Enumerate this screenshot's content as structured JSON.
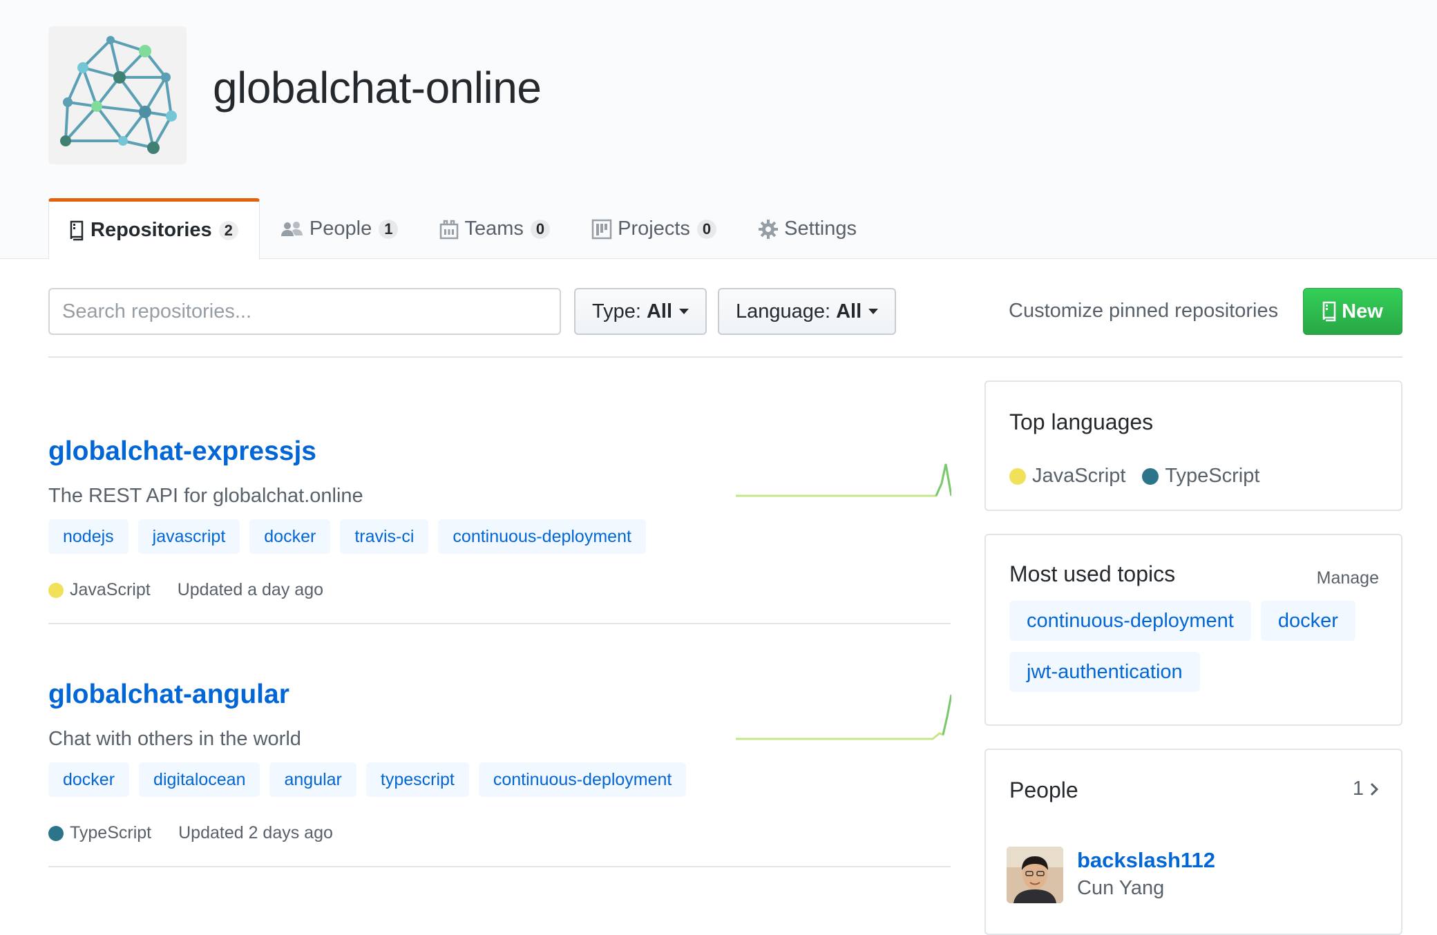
{
  "org": {
    "name": "globalchat-online",
    "avatar_icon": "network-graph-logo"
  },
  "tabs": [
    {
      "label": "Repositories",
      "count": "2",
      "icon": "repo-icon"
    },
    {
      "label": "People",
      "count": "1",
      "icon": "people-icon"
    },
    {
      "label": "Teams",
      "count": "0",
      "icon": "teams-icon"
    },
    {
      "label": "Projects",
      "count": "0",
      "icon": "project-icon"
    },
    {
      "label": "Settings",
      "icon": "gear-icon"
    }
  ],
  "filters": {
    "search_placeholder": "Search repositories...",
    "type_label": "Type:",
    "type_value": "All",
    "language_label": "Language:",
    "language_value": "All",
    "customize_link": "Customize pinned repositories",
    "new_button": "New"
  },
  "repos": [
    {
      "name": "globalchat-expressjs",
      "description": "The REST API for globalchat.online",
      "topics": [
        "nodejs",
        "javascript",
        "docker",
        "travis-ci",
        "continuous-deployment"
      ],
      "language": "JavaScript",
      "language_color": "#f1e05a",
      "updated": "Updated a day ago"
    },
    {
      "name": "globalchat-angular",
      "description": "Chat with others in the world",
      "topics": [
        "docker",
        "digitalocean",
        "angular",
        "typescript",
        "continuous-deployment"
      ],
      "language": "TypeScript",
      "language_color": "#2b7489",
      "updated": "Updated 2 days ago"
    }
  ],
  "sidebar": {
    "top_languages": {
      "title": "Top languages",
      "items": [
        {
          "name": "JavaScript",
          "color": "#f1e05a"
        },
        {
          "name": "TypeScript",
          "color": "#2b7489"
        }
      ]
    },
    "topics": {
      "title": "Most used topics",
      "manage": "Manage",
      "items": [
        "continuous-deployment",
        "docker",
        "jwt-authentication"
      ]
    },
    "people": {
      "title": "People",
      "count": "1",
      "members": [
        {
          "login": "backslash112",
          "name": "Cun Yang"
        }
      ]
    }
  },
  "colors": {
    "accent_tab": "#e36209",
    "link": "#0366d6",
    "new_button": "#28a745"
  }
}
